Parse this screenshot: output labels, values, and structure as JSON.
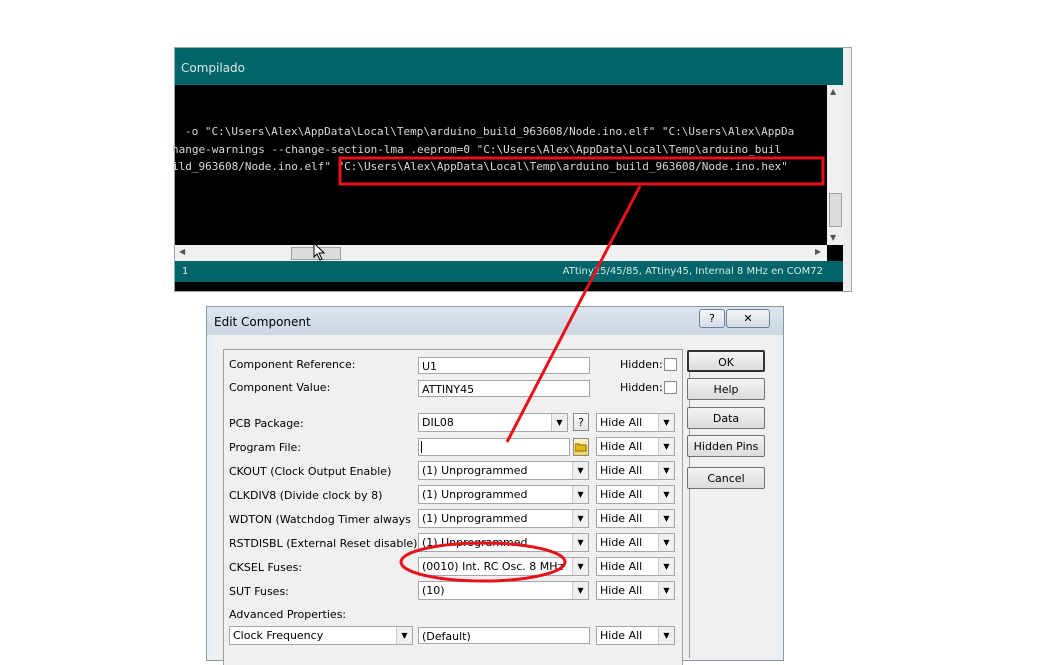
{
  "console": {
    "title": "Compilado",
    "lines": [
      "-o \"C:\\Users\\Alex\\AppData\\Local\\Temp\\arduino_build_963608/Node.ino.elf\" \"C:\\Users\\Alex\\AppDa",
      "hange-warnings --change-section-lma .eeprom=0  \"C:\\Users\\Alex\\AppData\\Local\\Temp\\arduino_buil",
      "ild_963608/Node.ino.elf\" \"C:\\Users\\Alex\\AppData\\Local\\Temp\\arduino_build_963608/Node.ino.hex\""
    ],
    "status_line": "1",
    "status_board": "ATtiny25/45/85, ATtiny45, Internal 8 MHz en COM72"
  },
  "dialog": {
    "title": "Edit Component",
    "help_glyph": "?",
    "close_glyph": "✕",
    "fields": {
      "component_reference": {
        "label": "Component Reference:",
        "value": "U1"
      },
      "component_value": {
        "label": "Component Value:",
        "value": "ATTINY45"
      },
      "hidden_label": "Hidden:",
      "pcb_package": {
        "label": "PCB Package:",
        "value": "DIL08",
        "help": "?",
        "visibility": "Hide All"
      },
      "program_file": {
        "label": "Program File:",
        "value": "",
        "visibility": "Hide All"
      },
      "ckout": {
        "label": "CKOUT (Clock Output Enable)",
        "value": "(1) Unprogrammed",
        "visibility": "Hide All"
      },
      "clkdiv8": {
        "label": "CLKDIV8 (Divide clock by 8)",
        "value": "(1) Unprogrammed",
        "visibility": "Hide All"
      },
      "wdton": {
        "label": "WDTON (Watchdog Timer always on)",
        "value": "(1) Unprogrammed",
        "visibility": "Hide All"
      },
      "rstdisbl": {
        "label": "RSTDISBL (External Reset disable)",
        "value": "(1) Unprogrammed",
        "visibility": "Hide All"
      },
      "cksel": {
        "label": "CKSEL Fuses:",
        "value": "(0010) Int. RC Osc. 8 MHz",
        "visibility": "Hide All"
      },
      "sut": {
        "label": "SUT Fuses:",
        "value": "(10)",
        "visibility": "Hide All"
      },
      "advanced_label": "Advanced Properties:",
      "advanced": {
        "property": "Clock Frequency",
        "value": "(Default)",
        "visibility": "Hide All"
      }
    },
    "buttons": {
      "ok": "OK",
      "help": "Help",
      "data": "Data",
      "hidden_pins": "Hidden Pins",
      "cancel": "Cancel"
    }
  },
  "colors": {
    "arduino_teal": "#006468",
    "annotation_red": "#e8101a"
  }
}
